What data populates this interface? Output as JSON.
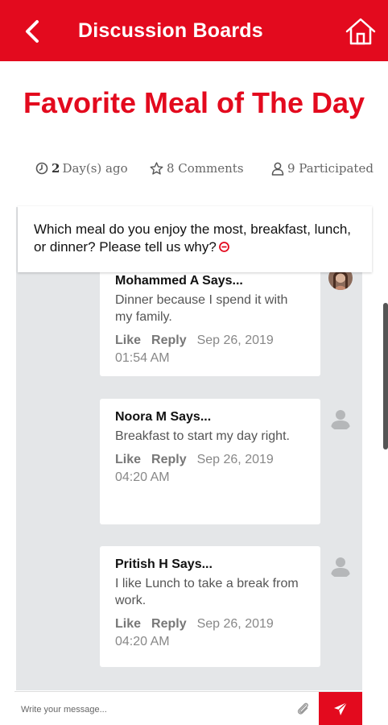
{
  "header": {
    "title": "Discussion Boards",
    "back_icon": "chevron-left-icon",
    "home_icon": "home-icon",
    "bg_color": "#e30a1e"
  },
  "topic": {
    "title": "Favorite Meal of The Day",
    "time_count": "2",
    "time_unit": "Day(s) ago",
    "comments": "8 Comments",
    "participants": "9 Participated"
  },
  "question": {
    "text": "Which meal do you enjoy the most, breakfast, lunch, or dinner? Please tell us why?"
  },
  "comments": [
    {
      "author": "Mohammed A Says...",
      "text": "Dinner because I spend it with my family.",
      "like": "Like",
      "reply": "Reply",
      "date": "Sep 26, 2019",
      "time": "01:54 AM"
    },
    {
      "author": "Noora M Says...",
      "text": "Breakfast to start my day right.",
      "like": "Like",
      "reply": "Reply",
      "date": "Sep 26, 2019",
      "time": "04:20 AM"
    },
    {
      "author": "Pritish H Says...",
      "text": "I like Lunch to take a break from work.",
      "like": "Like",
      "reply": "Reply",
      "date": "Sep 26, 2019",
      "time": "04:20 AM"
    }
  ],
  "composer": {
    "placeholder": "Write your message..."
  },
  "colors": {
    "accent": "#e30a1e",
    "thread_bg": "#e4e6e8"
  }
}
